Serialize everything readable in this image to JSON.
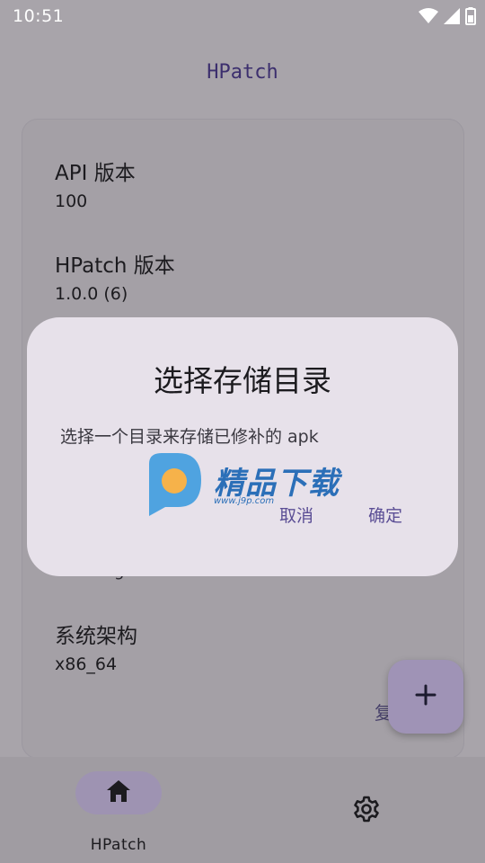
{
  "status_bar": {
    "time": "10:51",
    "icons": [
      "wifi-icon",
      "signal-icon",
      "battery-icon"
    ]
  },
  "app": {
    "title": "HPatch"
  },
  "info": {
    "items": [
      {
        "label": "API 版本",
        "value": "100"
      },
      {
        "label": "HPatch 版本",
        "value": "1.0.0 (6)"
      },
      {
        "label": "系统架构",
        "value": "x86_64"
      }
    ],
    "partial_hidden_text": "g",
    "copy_label": "复"
  },
  "dialog": {
    "title": "选择存储目录",
    "body": "选择一个目录来存储已修补的 apk",
    "cancel_label": "取消",
    "ok_label": "确定"
  },
  "fab": {
    "icon": "plus-icon"
  },
  "bottom_nav": {
    "items": [
      {
        "label": "HPatch",
        "icon": "home-icon",
        "selected": true
      },
      {
        "label": "",
        "icon": "gear-icon",
        "selected": false
      }
    ]
  },
  "watermark": {
    "text": "精品下载",
    "url": "www.j9p.com"
  },
  "colors": {
    "accent": "#5b4e95",
    "dialog_bg": "#e7e1ea",
    "scrim_bg": "#a8a4aa"
  }
}
